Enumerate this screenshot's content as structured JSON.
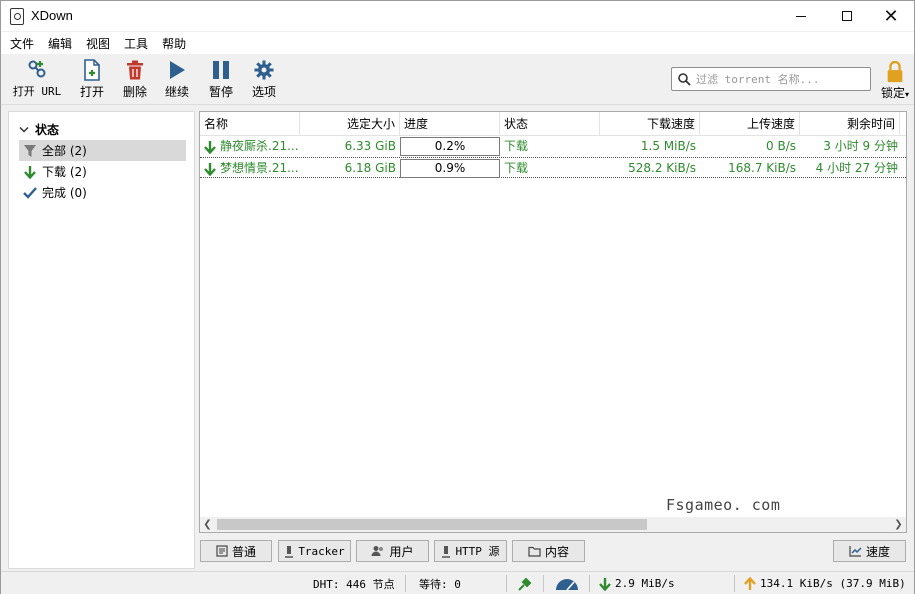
{
  "window": {
    "title": "XDown"
  },
  "menu": [
    "文件",
    "编辑",
    "视图",
    "工具",
    "帮助"
  ],
  "toolbar": {
    "open_url": "打开 URL",
    "open": "打开",
    "delete": "删除",
    "resume": "继续",
    "pause": "暂停",
    "options": "选项",
    "search_placeholder": "过滤 torrent 名称...",
    "lock": "锁定"
  },
  "sidebar": {
    "header": "状态",
    "items": [
      {
        "label": "全部 (2)",
        "icon": "filter-icon"
      },
      {
        "label": "下载 (2)",
        "icon": "download-arrow-icon"
      },
      {
        "label": "完成 (0)",
        "icon": "checkmark-icon"
      }
    ]
  },
  "list": {
    "columns": [
      "名称",
      "选定大小",
      "进度",
      "状态",
      "下载速度",
      "上传速度",
      "剩余时间"
    ],
    "rows": [
      {
        "name": "静夜厮杀.21...",
        "size": "6.33 GiB",
        "progress_text": "0.2%",
        "progress": 0.002,
        "status": "下载",
        "down": "1.5 MiB/s",
        "up": "0 B/s",
        "eta": "3 小时 9 分钟"
      },
      {
        "name": "梦想情景.21...",
        "size": "6.18 GiB",
        "progress_text": "0.9%",
        "progress": 0.009,
        "status": "下载",
        "down": "528.2 KiB/s",
        "up": "168.7 KiB/s",
        "eta": "4 小时 27 分钟"
      }
    ],
    "watermark": "Fsgameo. com"
  },
  "bottom_tabs": {
    "general": "普通",
    "tracker": "Tracker",
    "peers": "用户",
    "http_sources": "HTTP 源",
    "content": "内容",
    "speed": "速度"
  },
  "status": {
    "dht": "DHT: 446 节点",
    "queue": "等待: 0",
    "down_speed": "2.9 MiB/s",
    "up_speed": "134.1 KiB/s (37.9 MiB)"
  },
  "colors": {
    "green_text": "#2e8b2e",
    "lock_orange": "#e0a020",
    "delete_red": "#c0392b",
    "icon_blue": "#2f5f8f"
  }
}
